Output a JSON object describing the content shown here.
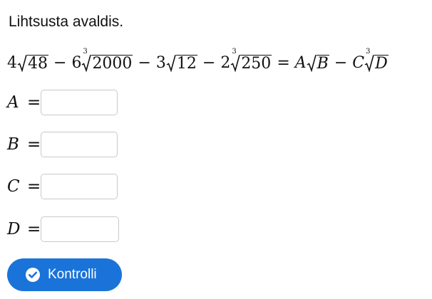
{
  "instruction": "Lihtsusta avaldis.",
  "equation": {
    "term1": {
      "coef": "4",
      "radicand": "48"
    },
    "op1": "−",
    "term2": {
      "coef": "6",
      "index": "3",
      "radicand": "2000"
    },
    "op2": "−",
    "term3": {
      "coef": "3",
      "radicand": "12"
    },
    "op3": "−",
    "term4": {
      "coef": "2",
      "index": "3",
      "radicand": "250"
    },
    "eq": "=",
    "rhs1": {
      "coef": "A",
      "radicand": "B"
    },
    "op4": "−",
    "rhs2": {
      "coef": "C",
      "index": "3",
      "radicand": "D"
    }
  },
  "fields": [
    {
      "label": "A",
      "eq": "=",
      "value": ""
    },
    {
      "label": "B",
      "eq": "=",
      "value": ""
    },
    {
      "label": "C",
      "eq": "=",
      "value": ""
    },
    {
      "label": "D",
      "eq": "=",
      "value": ""
    }
  ],
  "check_button": {
    "label": "Kontrolli",
    "icon": "check-circle-icon",
    "color": "#1a73d9"
  }
}
